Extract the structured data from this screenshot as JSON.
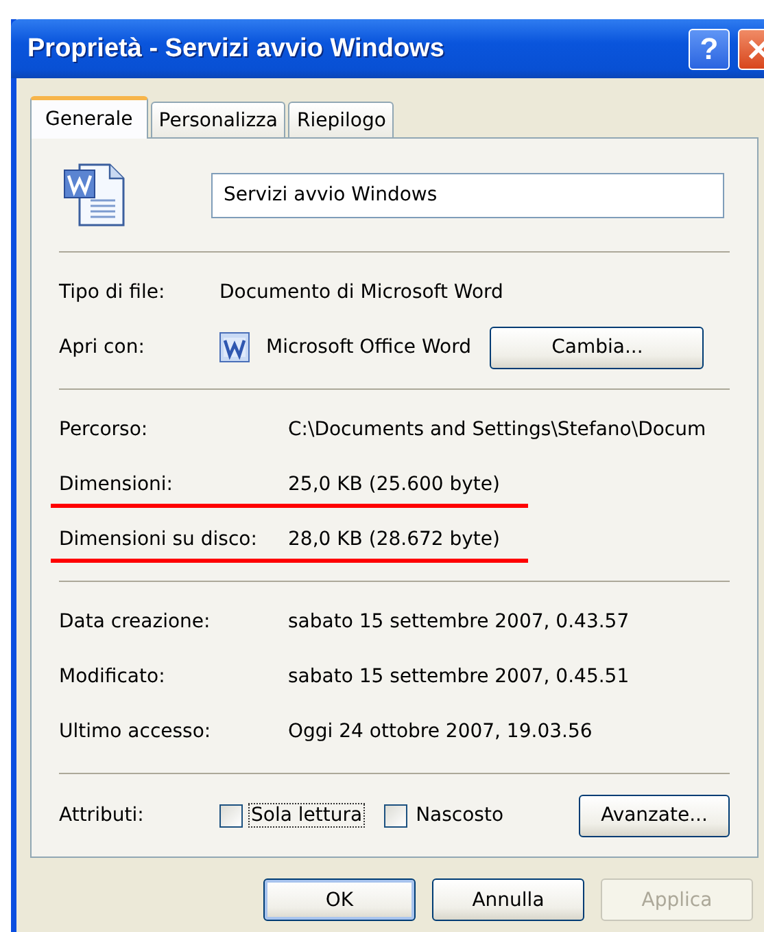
{
  "window": {
    "title": "Proprietà - Servizi avvio Windows",
    "help_button": "?"
  },
  "tabs": [
    {
      "label": "Generale",
      "selected": true
    },
    {
      "label": "Personalizza",
      "selected": false
    },
    {
      "label": "Riepilogo",
      "selected": false
    }
  ],
  "file": {
    "name": "Servizi avvio Windows"
  },
  "type_rows": [
    {
      "kind": "text",
      "label": "Tipo di file:",
      "value": "Documento di Microsoft Word"
    },
    {
      "kind": "app",
      "label": "Apri con:",
      "value": "Microsoft Office Word",
      "button": "Cambia..."
    }
  ],
  "location_rows": [
    {
      "label": "Percorso:",
      "value": "C:\\Documents and Settings\\Stefano\\Docum",
      "highlighted": false
    },
    {
      "label": "Dimensioni:",
      "value": "25,0 KB (25.600 byte)",
      "highlighted": true
    },
    {
      "label": "Dimensioni su disco:",
      "value": "28,0 KB (28.672 byte)",
      "highlighted": true
    }
  ],
  "date_rows": [
    {
      "label": "Data creazione:",
      "value": "sabato 15 settembre 2007, 0.43.57"
    },
    {
      "label": "Modificato:",
      "value": "sabato 15 settembre 2007, 0.45.51"
    },
    {
      "label": "Ultimo accesso:",
      "value": "Oggi 24 ottobre 2007, 19.03.56"
    }
  ],
  "attributes": {
    "label": "Attributi:",
    "checkboxes": [
      {
        "label": "Sola lettura",
        "checked": false,
        "focused": true
      },
      {
        "label": "Nascosto",
        "checked": false,
        "focused": false
      }
    ],
    "button": "Avanzate..."
  },
  "buttons": [
    {
      "label": "OK",
      "default": true,
      "disabled": false
    },
    {
      "label": "Annulla",
      "default": false,
      "disabled": false
    },
    {
      "label": "Applica",
      "default": false,
      "disabled": true
    }
  ]
}
